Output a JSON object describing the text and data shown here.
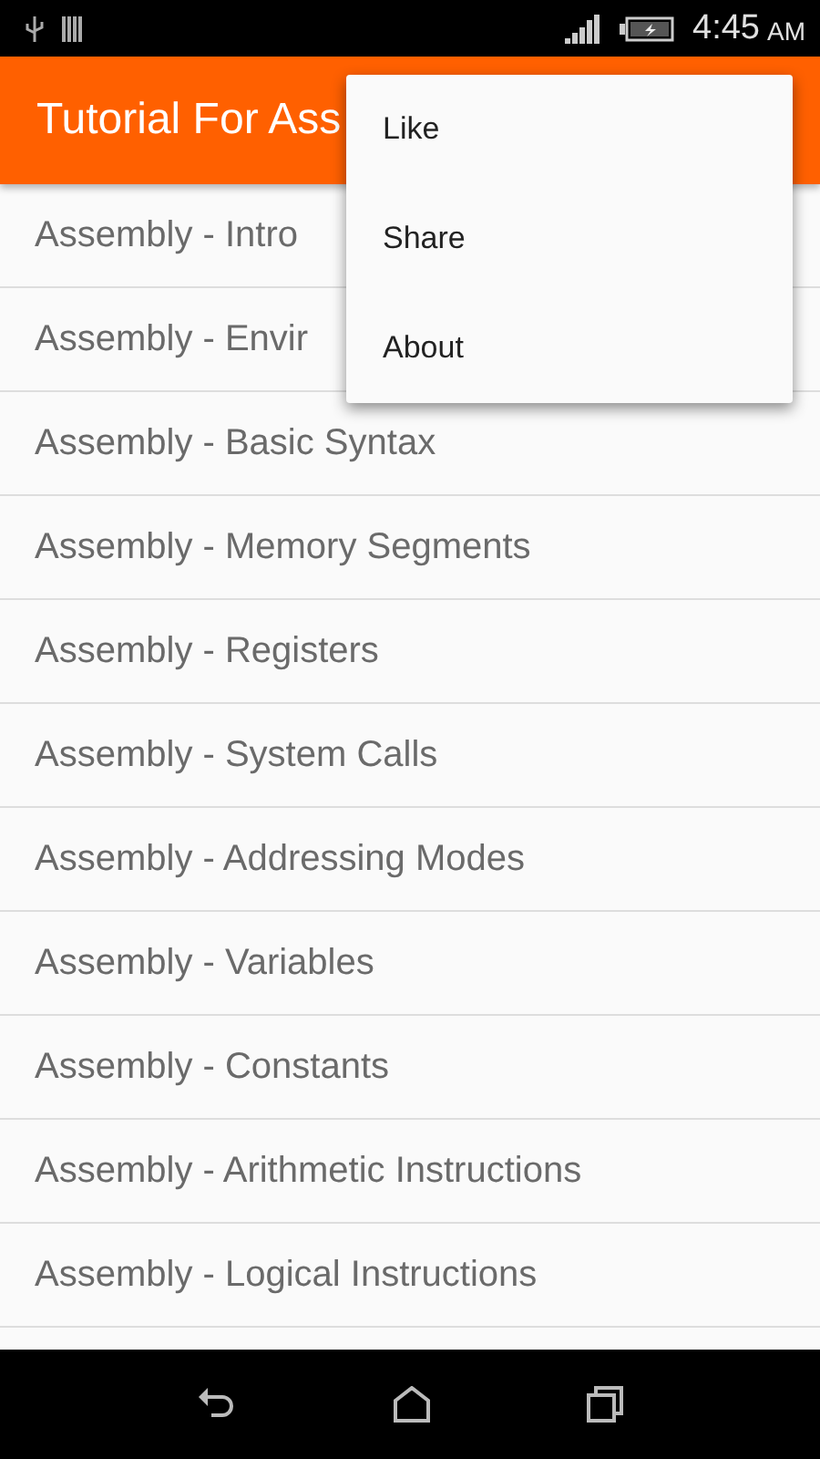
{
  "status_bar": {
    "time": "4:45",
    "meridiem": "AM"
  },
  "app_bar": {
    "title": "Tutorial For Ass"
  },
  "lessons": [
    {
      "title": "Assembly - Intro"
    },
    {
      "title": "Assembly - Envir"
    },
    {
      "title": "Assembly - Basic Syntax"
    },
    {
      "title": "Assembly - Memory Segments"
    },
    {
      "title": "Assembly - Registers"
    },
    {
      "title": "Assembly - System Calls"
    },
    {
      "title": "Assembly - Addressing Modes"
    },
    {
      "title": "Assembly - Variables"
    },
    {
      "title": "Assembly - Constants"
    },
    {
      "title": "Assembly - Arithmetic Instructions"
    },
    {
      "title": "Assembly - Logical Instructions"
    }
  ],
  "menu": {
    "items": [
      {
        "label": "Like"
      },
      {
        "label": "Share"
      },
      {
        "label": "About"
      }
    ]
  }
}
